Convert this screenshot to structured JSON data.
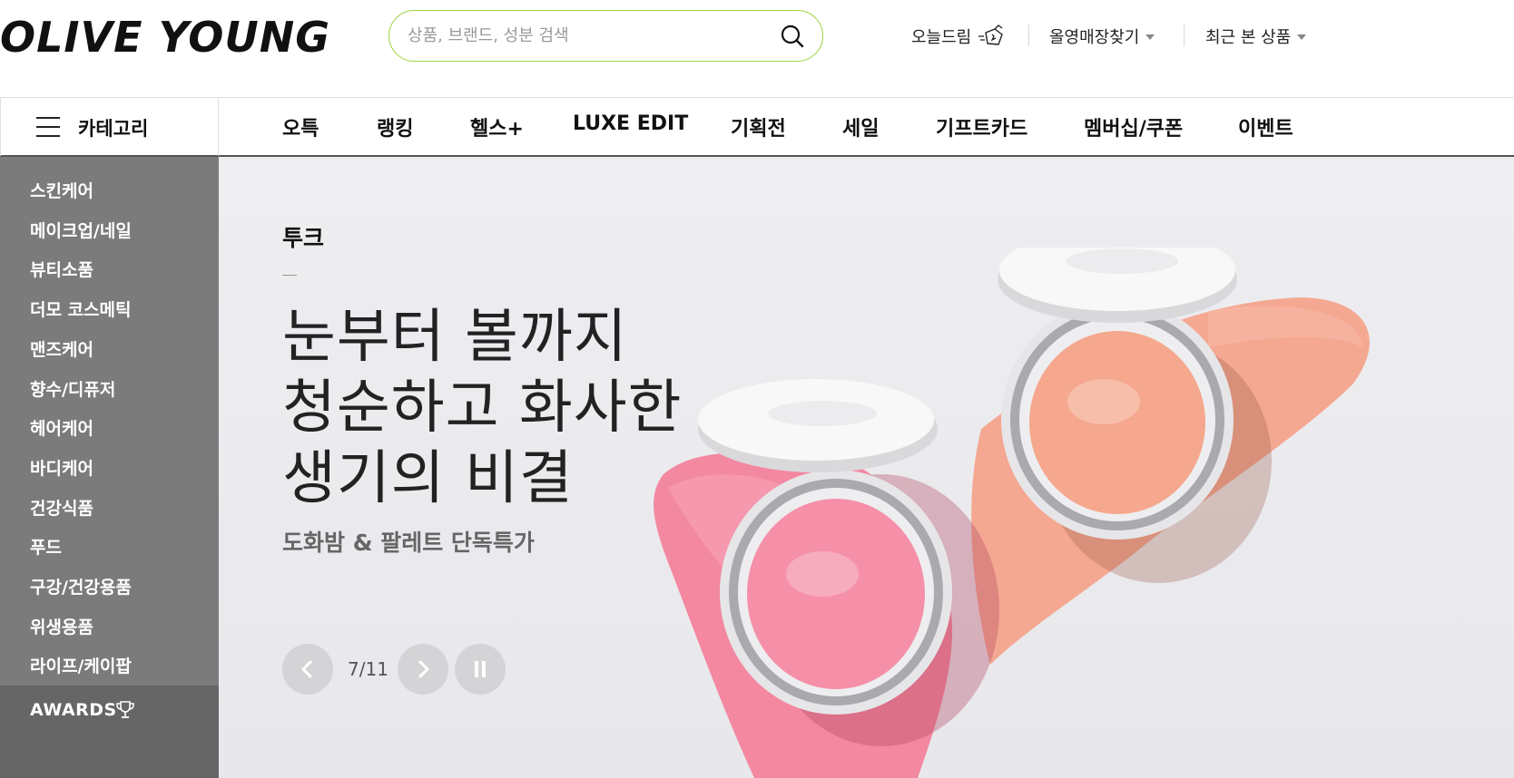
{
  "header": {
    "logo": "OLIVE YOUNG",
    "search_placeholder": "상품, 브랜드, 성분 검색",
    "utils": [
      {
        "label": "오늘드림",
        "icon": "delivery-icon"
      },
      {
        "label": "올영매장찾기",
        "icon": "caret-down-icon"
      },
      {
        "label": "최근 본 상품",
        "icon": "caret-down-icon"
      }
    ]
  },
  "gnb": {
    "category_label": "카테고리",
    "items": [
      "오특",
      "랭킹",
      "헬스+",
      "LUXE EDIT",
      "기획전",
      "세일",
      "기프트카드",
      "멤버십/쿠폰",
      "이벤트"
    ]
  },
  "sidebar": {
    "items": [
      "스킨케어",
      "메이크업/네일",
      "뷰티소품",
      "더모 코스메틱",
      "맨즈케어",
      "향수/디퓨저",
      "헤어케어",
      "바디케어",
      "건강식품",
      "푸드",
      "구강/건강용품",
      "위생용품",
      "라이프/케이팝"
    ],
    "awards_label": "AWARDS"
  },
  "hero": {
    "brand": "투크",
    "headline": [
      "눈부터 볼까지",
      "청순하고 화사한",
      "생기의 비결"
    ],
    "subline": "도화밤 & 팔레트 단독특가",
    "slide_current": 7,
    "slide_total": 11,
    "counter": "7/11"
  },
  "colors": {
    "search_border": "#9bd341",
    "sidebar_bg": "#7b7b7b",
    "awards_bg": "#666666",
    "hero_bg": "#ececef",
    "pink_balm": "#f3839c",
    "coral_balm": "#f4a48c"
  }
}
